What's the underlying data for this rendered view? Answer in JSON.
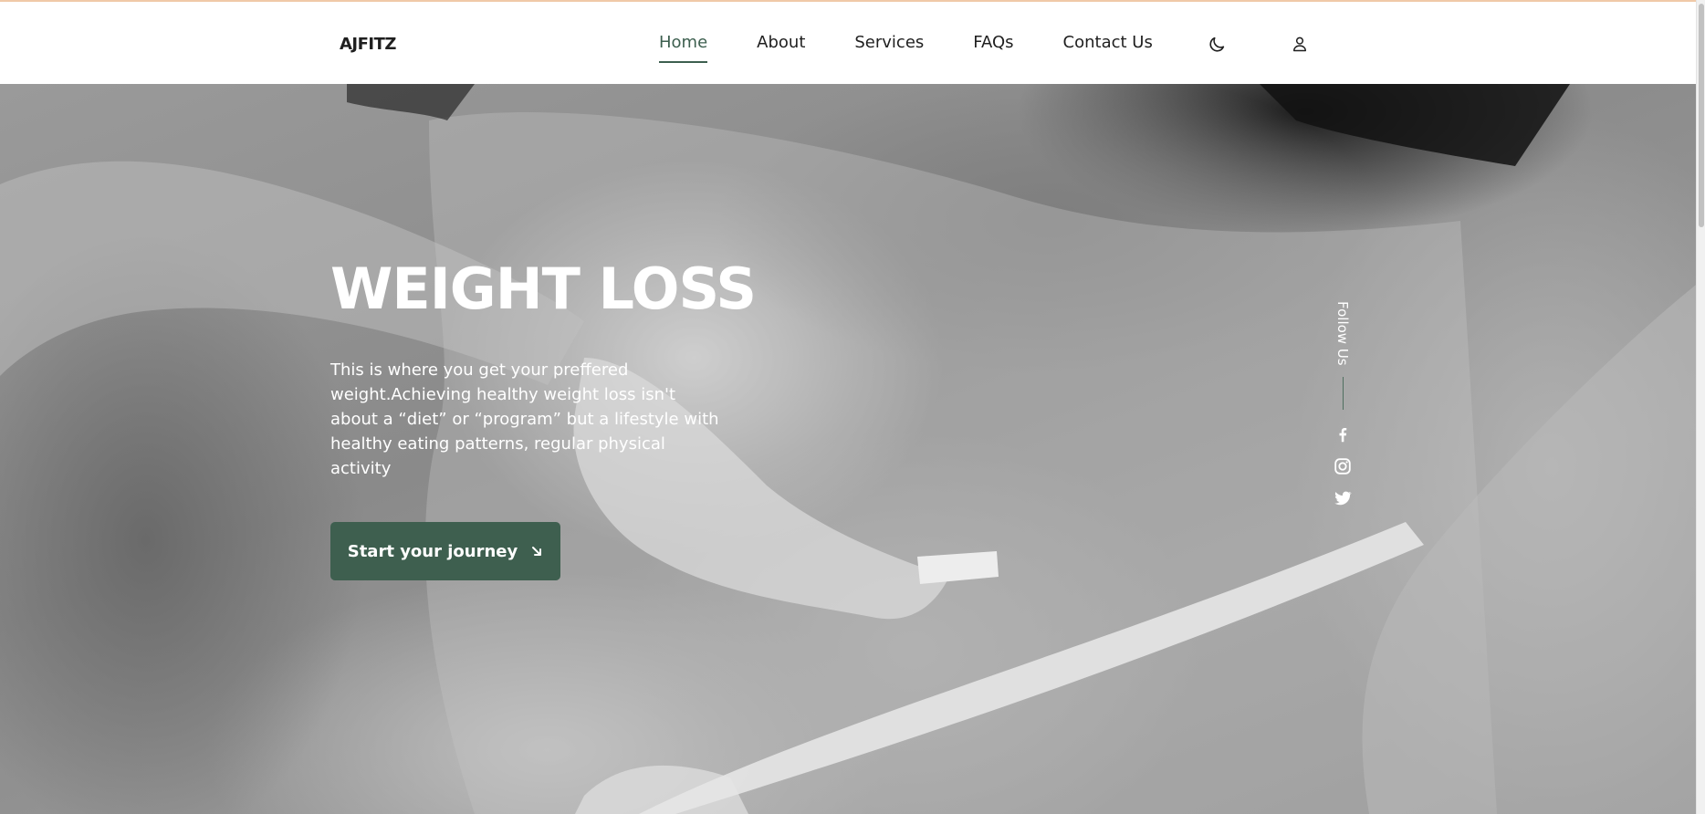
{
  "header": {
    "logo": "AJFITZ",
    "nav": [
      {
        "label": "Home",
        "active": true
      },
      {
        "label": "About",
        "active": false
      },
      {
        "label": "Services",
        "active": false
      },
      {
        "label": "FAQs",
        "active": false
      },
      {
        "label": "Contact Us",
        "active": false
      }
    ],
    "icons": {
      "theme_toggle": "moon-icon",
      "account": "user-icon"
    }
  },
  "hero": {
    "title": "WEIGHT LOSS",
    "text": "This is where you get your preffered weight.Achieving healthy weight loss isn't about a “diet” or “program” but a lifestyle with healthy eating patterns, regular physical activity",
    "cta_label": "Start your journey",
    "cta_icon": "arrow-down-right-icon"
  },
  "social": {
    "label": "Follow Us",
    "icons": [
      "facebook-icon",
      "instagram-icon",
      "twitter-icon"
    ]
  },
  "colors": {
    "accent": "#3e5f4f",
    "text_dark": "#1f1f1f",
    "top_border": "#f0c9a8"
  }
}
